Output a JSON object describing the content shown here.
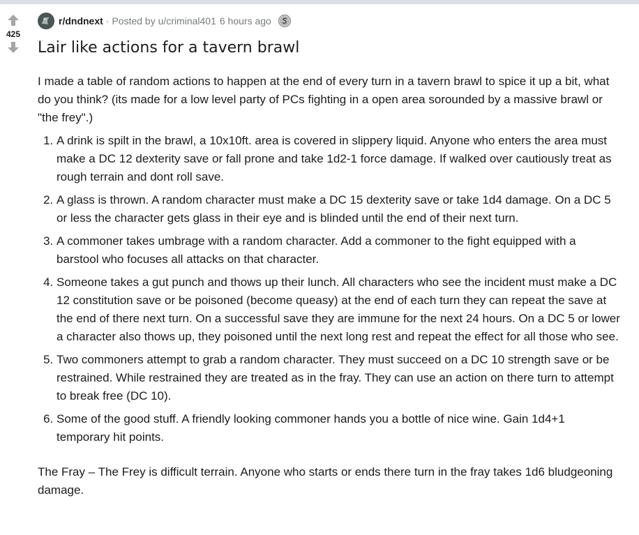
{
  "post": {
    "votes": "425",
    "subreddit": "r/dndnext",
    "separator": "·",
    "posted_by": "Posted by u/criminal401",
    "time": "6 hours ago",
    "title": "Lair like actions for a tavern brawl",
    "intro": "I made a table of random actions to happen at the end of every turn in a tavern brawl to spice it up a bit, what do you think? (its made for a low level party of PCs fighting in a open area sorounded by a massive brawl or \"the frey\".)",
    "items": [
      "A drink is spilt in the brawl, a 10x10ft. area is covered in slippery liquid. Anyone who enters the area must make a DC 12 dexterity save or fall prone and take 1d2-1 force damage. If walked over cautiously treat as rough terrain and dont roll save.",
      "A glass is thrown. A random character must make a DC 15 dexterity save or take 1d4 damage. On a DC 5 or less the character gets glass in their eye and is blinded until the end of their next turn.",
      "A commoner takes umbrage with a random character. Add a commoner to the fight equipped with a barstool who focuses all attacks on that character.",
      "Someone takes a gut punch and thows up their lunch. All characters who see the incident must make a DC 12 constitution save or be poisoned (become queasy) at the end of each turn they can repeat the save at the end of there next turn. On a successful save they are immune for the next 24 hours. On a DC 5 or lower a character also thows up, they poisoned until the next long rest and repeat the effect for all those who see.",
      "Two commoners attempt to grab a random character. They must succeed on a DC 10 strength save or be restrained. While restrained they are treated as in the fray. They can use an action on there turn to attempt to break free (DC 10).",
      "Some of the good stuff. A friendly looking commoner hands you a bottle of nice wine. Gain 1d4+1 temporary hit points."
    ],
    "footer": "The Fray – The Frey is difficult terrain. Anyone who starts or ends there turn in the fray takes 1d6 bludgeoning damage."
  },
  "icons": {
    "upvote": "upvote-arrow-icon",
    "downvote": "downvote-arrow-icon",
    "avatar": "subreddit-avatar-icon",
    "award": "silver-award-icon"
  },
  "colors": {
    "vote_arrow": "#a5a5a5",
    "meta_text": "#787c7e",
    "text": "#1c1c1c",
    "topbar": "#dae0e6"
  }
}
